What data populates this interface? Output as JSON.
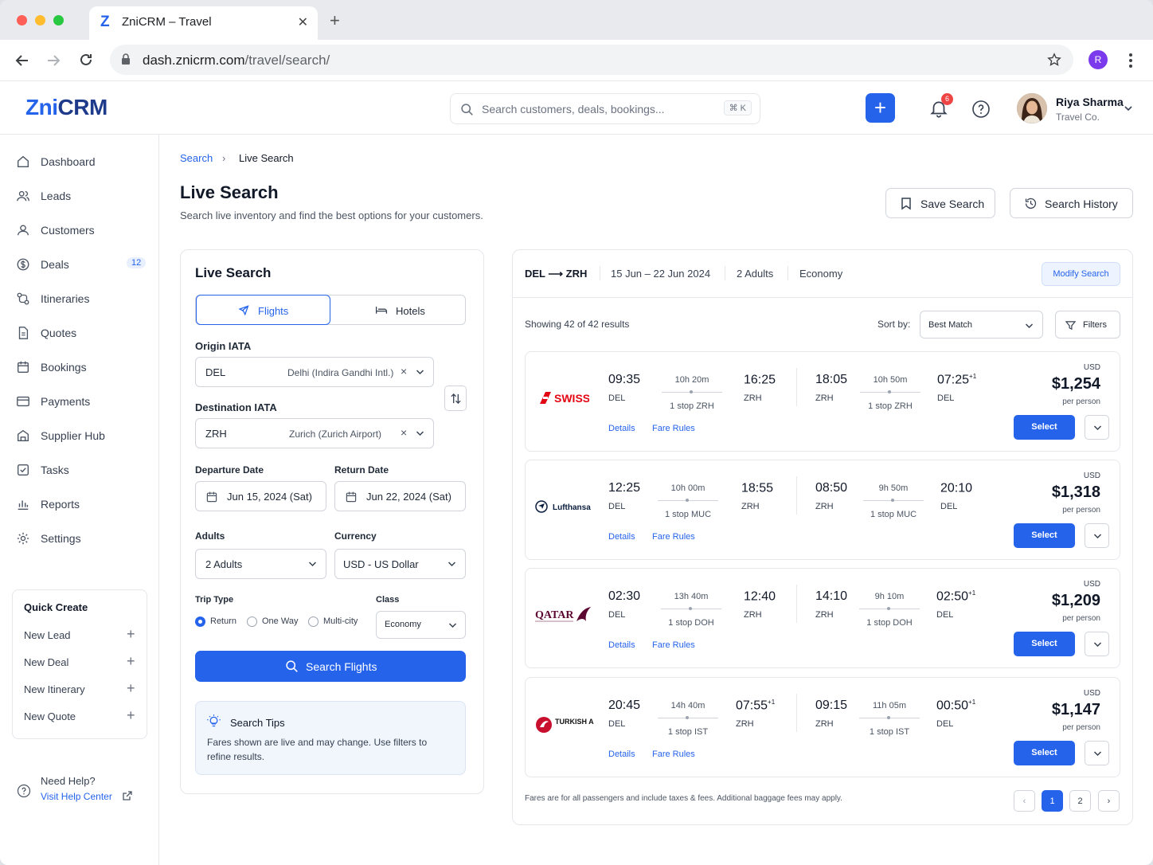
{
  "browser": {
    "tab_title": "ZniCRM – Travel",
    "tab_logo": "Z",
    "url_host": "dash.znicrm.com",
    "url_path": "/travel/search/",
    "profile_initial": "R"
  },
  "header": {
    "logo_prefix": "Zni",
    "logo_suffix": "CRM",
    "search_placeholder": "Search customers, deals, bookings...",
    "search_shortcut": "⌘ K",
    "notification_count": "6",
    "user_name": "Riya Sharma",
    "user_company": "Travel Co."
  },
  "sidebar": {
    "items": [
      {
        "label": "Dashboard",
        "icon": "home-icon"
      },
      {
        "label": "Leads",
        "icon": "users-icon"
      },
      {
        "label": "Customers",
        "icon": "user-icon"
      },
      {
        "label": "Deals",
        "icon": "dollar-icon",
        "count": "12"
      },
      {
        "label": "Itineraries",
        "icon": "route-icon"
      },
      {
        "label": "Quotes",
        "icon": "document-icon"
      },
      {
        "label": "Bookings",
        "icon": "calendar-icon"
      },
      {
        "label": "Payments",
        "icon": "card-icon"
      },
      {
        "label": "Supplier Hub",
        "icon": "building-icon"
      },
      {
        "label": "Tasks",
        "icon": "checkbox-icon"
      },
      {
        "label": "Reports",
        "icon": "chart-icon"
      },
      {
        "label": "Settings",
        "icon": "gear-icon"
      }
    ],
    "quick_create": {
      "title": "Quick Create",
      "items": [
        "New Lead",
        "New Deal",
        "New Itinerary",
        "New Quote"
      ]
    },
    "help_title": "Need Help?",
    "help_link": "Visit Help Center"
  },
  "page": {
    "breadcrumb_root": "Search",
    "breadcrumb_current": "Live Search",
    "title": "Live Search",
    "subtitle": "Search live inventory and find the best options for your customers.",
    "save_search": "Save Search",
    "search_history": "Search History"
  },
  "form": {
    "title": "Live Search",
    "tab_flights": "Flights",
    "tab_hotels": "Hotels",
    "origin_label": "Origin IATA",
    "origin_code": "DEL",
    "origin_name": "Delhi (Indira Gandhi Intl.)",
    "dest_label": "Destination IATA",
    "dest_code": "ZRH",
    "dest_name": "Zurich (Zurich Airport)",
    "departure_label": "Departure Date",
    "departure_value": "Jun 15, 2024 (Sat)",
    "return_label": "Return Date",
    "return_value": "Jun 22, 2024 (Sat)",
    "adults_label": "Adults",
    "adults_value": "2 Adults",
    "currency_label": "Currency",
    "currency_value": "USD - US Dollar",
    "trip_type_label": "Trip Type",
    "trip_types": [
      "Return",
      "One Way",
      "Multi-city"
    ],
    "trip_type_selected": "Return",
    "class_label": "Class",
    "class_value": "Economy",
    "search_button": "Search Flights",
    "tips_title": "Search Tips",
    "tips_text_1": "Fares shown are live and may change. Use filters to",
    "tips_text_2": "refine results."
  },
  "results": {
    "route": "DEL ⟶ ZRH",
    "dates": "15 Jun – 22 Jun 2024",
    "pax": "2 Adults",
    "cabin": "Economy",
    "modify": "Modify Search",
    "showing": "Showing 42 of 42 results",
    "sort_label": "Sort by:",
    "sort_value": "Best Match",
    "filters": "Filters",
    "flights": [
      {
        "airline": "SWISS",
        "color": "#e30613",
        "out_dep": "09:35",
        "out_from": "DEL",
        "out_dur": "10h 20m",
        "out_stop": "1 stop ZRH",
        "out_arr": "16:25",
        "out_arr_sup": "",
        "out_to": "ZRH",
        "ret_dep": "18:05",
        "ret_from": "ZRH",
        "ret_dur": "10h 50m",
        "ret_stop": "1 stop ZRH",
        "ret_arr": "07:25",
        "ret_arr_sup": "+1",
        "ret_to": "DEL",
        "currency": "USD",
        "price": "$1,254",
        "per": "per person",
        "details": "Details",
        "fare_rules": "Fare Rules",
        "select": "Select"
      },
      {
        "airline": "Lufthansa",
        "color": "#0a1d3d",
        "out_dep": "12:25",
        "out_from": "DEL",
        "out_dur": "10h 00m",
        "out_stop": "1 stop MUC",
        "out_arr": "18:55",
        "out_arr_sup": "",
        "out_to": "ZRH",
        "ret_dep": "08:50",
        "ret_from": "ZRH",
        "ret_dur": "9h 50m",
        "ret_stop": "1 stop MUC",
        "ret_arr": "20:10",
        "ret_arr_sup": "",
        "ret_to": "DEL",
        "currency": "USD",
        "price": "$1,318",
        "per": "per person",
        "details": "Details",
        "fare_rules": "Fare Rules",
        "select": "Select"
      },
      {
        "airline": "QATAR",
        "color": "#5c0632",
        "out_dep": "02:30",
        "out_from": "DEL",
        "out_dur": "13h 40m",
        "out_stop": "1 stop DOH",
        "out_arr": "12:40",
        "out_arr_sup": "",
        "out_to": "ZRH",
        "ret_dep": "14:10",
        "ret_from": "ZRH",
        "ret_dur": "9h 10m",
        "ret_stop": "1 stop DOH",
        "ret_arr": "02:50",
        "ret_arr_sup": "+1",
        "ret_to": "DEL",
        "currency": "USD",
        "price": "$1,209",
        "per": "per person",
        "details": "Details",
        "fare_rules": "Fare Rules",
        "select": "Select"
      },
      {
        "airline": "TURKISH AIRLINES",
        "color": "#c8102e",
        "out_dep": "20:45",
        "out_from": "DEL",
        "out_dur": "14h 40m",
        "out_stop": "1 stop IST",
        "out_arr": "07:55",
        "out_arr_sup": "+1",
        "out_to": "ZRH",
        "ret_dep": "09:15",
        "ret_from": "ZRH",
        "ret_dur": "11h 05m",
        "ret_stop": "1 stop IST",
        "ret_arr": "00:50",
        "ret_arr_sup": "+1",
        "ret_to": "DEL",
        "currency": "USD",
        "price": "$1,147",
        "per": "per person",
        "details": "Details",
        "fare_rules": "Fare Rules",
        "select": "Select"
      }
    ],
    "footnote": "Fares are for all passengers and include taxes & fees. Additional baggage fees may apply.",
    "pages": [
      "1",
      "2"
    ],
    "current_page": "1"
  },
  "colors": {
    "accent": "#2563eb",
    "brand_dark": "#1e3a8a"
  }
}
